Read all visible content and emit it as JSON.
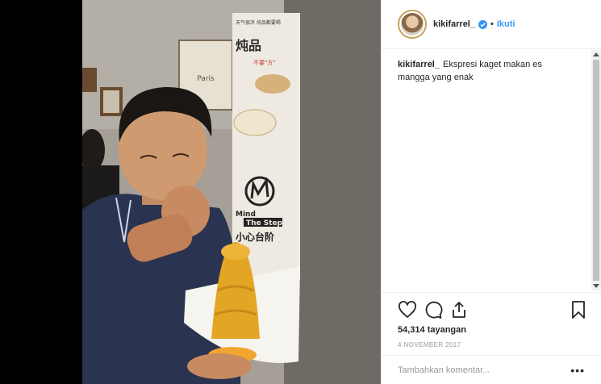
{
  "post": {
    "username": "kikifarrel_",
    "follow_label": "Ikuti",
    "separator": "•",
    "caption_user": "kikifarrel_",
    "caption_text": "Ekspresi kaget makan es mangga yang enak",
    "views": "54,314 tayangan",
    "date": "4 NOVEMBER 2017",
    "comment_placeholder": "Tambahkan komentar...",
    "more_label": "•••"
  },
  "media": {
    "poster_line1": "天气很凉 炖品都要喝",
    "poster_title": "炖品",
    "poster_line2": "不要\"方\"",
    "sign_en_1": "Mind",
    "sign_en_2": "The Step",
    "sign_cn": "小心台阶",
    "frame_label": "Paris"
  },
  "icons": {
    "like": "heart-icon",
    "comment": "comment-bubble-icon",
    "share": "share-icon",
    "save": "bookmark-icon",
    "verified": "verified-badge-icon"
  },
  "colors": {
    "link_blue": "#3897f0",
    "verified_blue": "#3897f0",
    "text": "#262626",
    "muted": "#999999"
  }
}
